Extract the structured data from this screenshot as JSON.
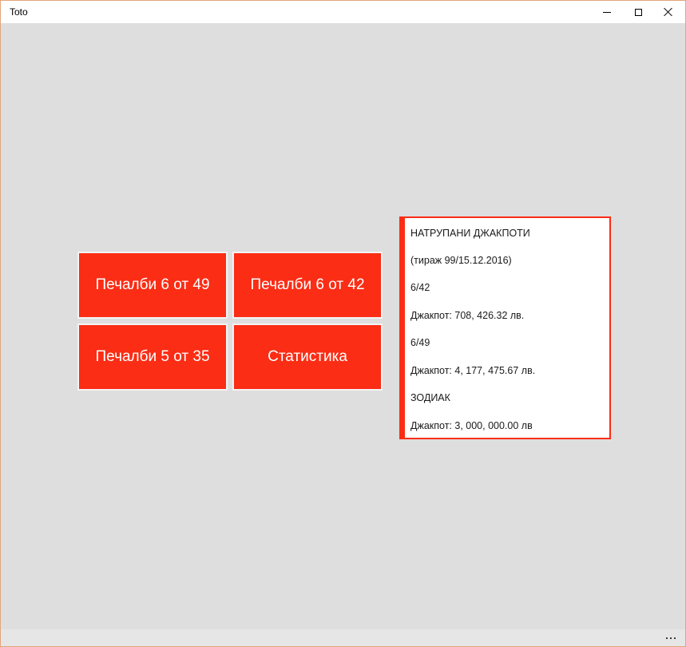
{
  "window": {
    "title": "Toto"
  },
  "tiles": [
    {
      "label": "Печалби 6 от 49"
    },
    {
      "label": "Печалби 6 от 42"
    },
    {
      "label": "Печалби 5 от 35"
    },
    {
      "label": "Статистика"
    }
  ],
  "jackpots": {
    "heading": "НАТРУПАНИ ДЖАКПОТИ",
    "draw": "(тираж 99/15.12.2016)",
    "game1_name": "6/42",
    "game1_jackpot": "Джакпот: 708, 426.32 лв.",
    "game2_name": "6/49",
    "game2_jackpot": "Джакпот: 4, 177, 475.67 лв.",
    "game3_name": "ЗОДИАК",
    "game3_jackpot": "Джакпот: 3, 000, 000.00 лв"
  },
  "colors": {
    "accent": "#fb2d15",
    "background": "#dedede"
  },
  "icons": {
    "minimize": "minimize-icon",
    "maximize": "maximize-icon",
    "close": "close-icon",
    "more": "more-icon"
  }
}
